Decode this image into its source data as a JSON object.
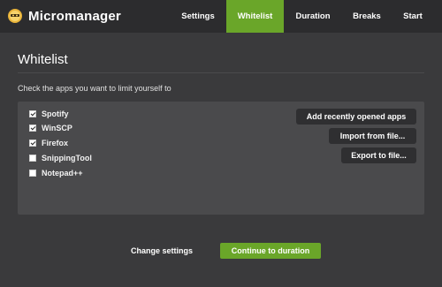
{
  "app": {
    "name": "Micromanager",
    "icon": "micromanager-logo-icon"
  },
  "nav": {
    "items": [
      {
        "label": "Settings",
        "active": false
      },
      {
        "label": "Whitelist",
        "active": true
      },
      {
        "label": "Duration",
        "active": false
      },
      {
        "label": "Breaks",
        "active": false
      },
      {
        "label": "Start",
        "active": false
      }
    ]
  },
  "page": {
    "title": "Whitelist",
    "instruction": "Check the apps you want to limit yourself to"
  },
  "apps": [
    {
      "label": "Spotify",
      "checked": true
    },
    {
      "label": "WinSCP",
      "checked": true
    },
    {
      "label": "Firefox",
      "checked": true
    },
    {
      "label": "SnippingTool",
      "checked": false
    },
    {
      "label": "Notepad++",
      "checked": false
    }
  ],
  "actions": {
    "add_recent": "Add recently opened apps",
    "import": "Import from file...",
    "export": "Export to file..."
  },
  "footer": {
    "change_settings": "Change settings",
    "continue": "Continue to duration"
  },
  "colors": {
    "accent": "#6aa629",
    "topbar": "#2c2c2e",
    "background": "#3a3a3c",
    "panel": "#4a4a4c"
  }
}
